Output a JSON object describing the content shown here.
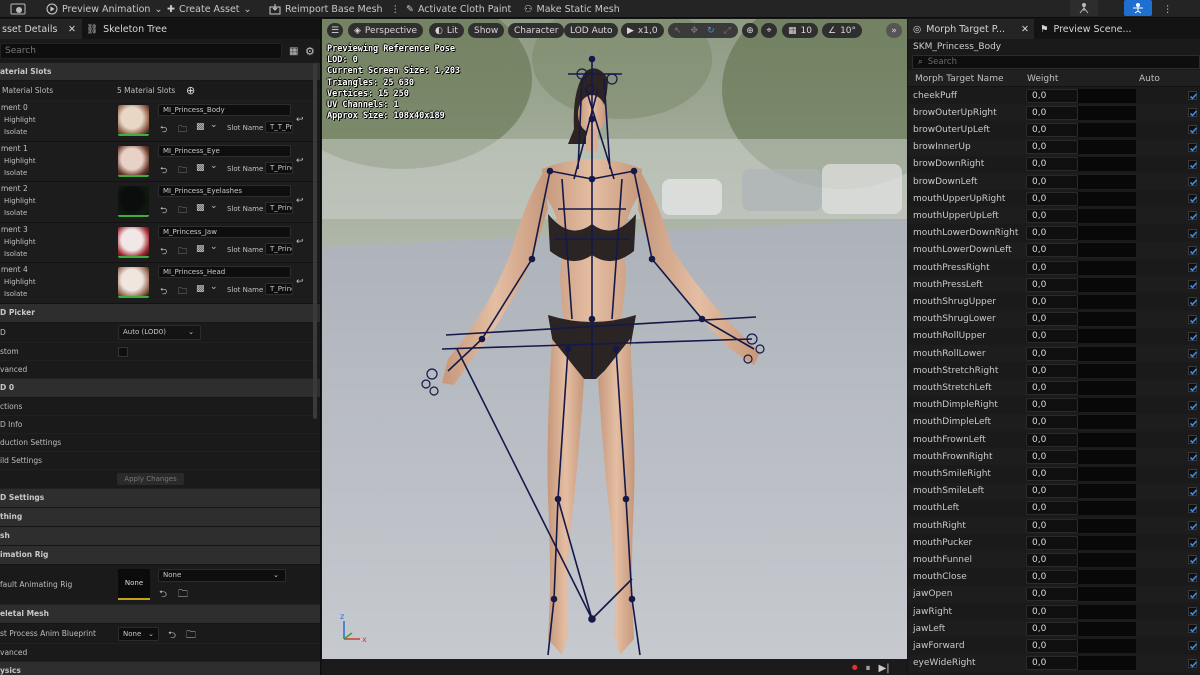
{
  "toolbar": {
    "preview_animation": "Preview Animation",
    "create_asset": "Create Asset",
    "reimport": "Reimport Base Mesh",
    "activate_cloth": "Activate Cloth Paint",
    "make_static": "Make Static Mesh"
  },
  "left_tabs": {
    "asset_details": "sset Details",
    "skeleton_tree": "Skeleton Tree"
  },
  "left_search": {
    "placeholder": "Search"
  },
  "material_slots": {
    "section": "aterial Slots",
    "label": "Material Slots",
    "count": "5 Material Slots",
    "highlight": "Highlight",
    "isolate": "Isolate",
    "slot_name_label": "Slot Name",
    "items": [
      {
        "element": "ment 0",
        "material": "MI_Princess_Body",
        "slot": "T_T_Pr"
      },
      {
        "element": "ment 1",
        "material": "MI_Princess_Eye",
        "slot": "T_Princ"
      },
      {
        "element": "ment 2",
        "material": "MI_Princess_Eyelashes",
        "slot": "T_Princ"
      },
      {
        "element": "ment 3",
        "material": "M_Princess_Jaw",
        "slot": "T_Princ"
      },
      {
        "element": "ment 4",
        "material": "MI_Princess_Head",
        "slot": "T_Princ"
      }
    ]
  },
  "lod_picker": {
    "section": "D Picker",
    "lod_label": "D",
    "lod_value": "Auto (LOD0)",
    "custom_label": "stom",
    "advanced_label": "vanced"
  },
  "lod0": {
    "section": "D 0",
    "sections_label": "ctions",
    "lod_info": "D Info",
    "reduction": "duction Settings",
    "build": "ild Settings",
    "apply": "Apply Changes"
  },
  "sections": {
    "lod_settings": "D Settings",
    "clothing": "thing",
    "mesh": "sh",
    "animation_rig": "imation Rig",
    "skeletal_mesh": "eletal Mesh",
    "physics": "ysics"
  },
  "animation_rig": {
    "default_label": "fault Animating Rig",
    "thumb_text": "None",
    "value": "None"
  },
  "skeletal_mesh": {
    "post_process_label": "st Process Anim Blueprint",
    "value": "None",
    "advanced_label": "vanced"
  },
  "viewport": {
    "perspective": "Perspective",
    "lit": "Lit",
    "show": "Show",
    "character": "Character",
    "lod_auto": "LOD Auto",
    "play_speed": "x1,0",
    "grid_value": "10",
    "angle_value": "10°",
    "stats": [
      "Previewing Reference Pose",
      "LOD: 0",
      "Current Screen Size: 1,203",
      "Triangles: 25 630",
      "Vertices: 15 250",
      "UV Channels: 1",
      "Approx Size: 108x40x189"
    ]
  },
  "right_tabs": {
    "morph": "Morph Target P...",
    "preview": "Preview Scene..."
  },
  "morph": {
    "mesh_name": "SKM_Princess_Body",
    "search_placeholder": "Search",
    "col_name": "Morph Target Name",
    "col_weight": "Weight",
    "col_auto": "Auto",
    "targets": [
      {
        "name": "cheekPuff",
        "weight": "0,0"
      },
      {
        "name": "browOuterUpRight",
        "weight": "0,0"
      },
      {
        "name": "browOuterUpLeft",
        "weight": "0,0"
      },
      {
        "name": "browInnerUp",
        "weight": "0,0"
      },
      {
        "name": "browDownRight",
        "weight": "0,0"
      },
      {
        "name": "browDownLeft",
        "weight": "0,0"
      },
      {
        "name": "mouthUpperUpRight",
        "weight": "0,0"
      },
      {
        "name": "mouthUpperUpLeft",
        "weight": "0,0"
      },
      {
        "name": "mouthLowerDownRight",
        "weight": "0,0"
      },
      {
        "name": "mouthLowerDownLeft",
        "weight": "0,0"
      },
      {
        "name": "mouthPressRight",
        "weight": "0,0"
      },
      {
        "name": "mouthPressLeft",
        "weight": "0,0"
      },
      {
        "name": "mouthShrugUpper",
        "weight": "0,0"
      },
      {
        "name": "mouthShrugLower",
        "weight": "0,0"
      },
      {
        "name": "mouthRollUpper",
        "weight": "0,0"
      },
      {
        "name": "mouthRollLower",
        "weight": "0,0"
      },
      {
        "name": "mouthStretchRight",
        "weight": "0,0"
      },
      {
        "name": "mouthStretchLeft",
        "weight": "0,0"
      },
      {
        "name": "mouthDimpleRight",
        "weight": "0,0"
      },
      {
        "name": "mouthDimpleLeft",
        "weight": "0,0"
      },
      {
        "name": "mouthFrownLeft",
        "weight": "0,0"
      },
      {
        "name": "mouthFrownRight",
        "weight": "0,0"
      },
      {
        "name": "mouthSmileRight",
        "weight": "0,0"
      },
      {
        "name": "mouthSmileLeft",
        "weight": "0,0"
      },
      {
        "name": "mouthLeft",
        "weight": "0,0"
      },
      {
        "name": "mouthRight",
        "weight": "0,0"
      },
      {
        "name": "mouthPucker",
        "weight": "0,0"
      },
      {
        "name": "mouthFunnel",
        "weight": "0,0"
      },
      {
        "name": "mouthClose",
        "weight": "0,0"
      },
      {
        "name": "jawOpen",
        "weight": "0,0"
      },
      {
        "name": "jawRight",
        "weight": "0,0"
      },
      {
        "name": "jawLeft",
        "weight": "0,0"
      },
      {
        "name": "jawForward",
        "weight": "0,0"
      },
      {
        "name": "eyeWideRight",
        "weight": "0,0"
      }
    ]
  },
  "colors": {
    "accent_blue": "#1f6fd1",
    "panel": "#1a1a1a",
    "section_header": "#2e2e2e",
    "bone_color": "#141a4a"
  }
}
